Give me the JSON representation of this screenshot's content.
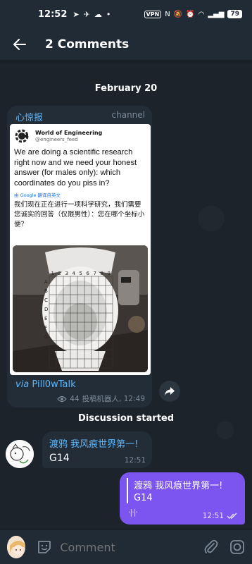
{
  "status_bar": {
    "time": "12:52",
    "vpn": "VPN",
    "battery": "79"
  },
  "header": {
    "title": "2 Comments"
  },
  "date_separator": "February 20",
  "channel_post": {
    "channel_name": "心惊报",
    "tag": "channel",
    "tweet": {
      "author": "World of Engineering",
      "handle": "@engineers_feed",
      "text": "We are doing a scientific research right now and we need your honest answer (for males only): which coordinates do you piss in?",
      "translate_label": "由 Google 翻译自英文",
      "translated_text": "我们现在正在进行一项科学研究，我们需要您诚实的回答（仅限男性）：您在哪个坐标小便？",
      "grid_columns": [
        "1",
        "2",
        "3",
        "4",
        "5",
        "6",
        "7",
        "8",
        "9"
      ],
      "grid_rows": [
        "A",
        "B",
        "C",
        "D",
        "E",
        "F",
        "G"
      ]
    },
    "via_prefix": "via",
    "via_name": "Pill0wTalk",
    "views": "44",
    "meta": "投稿机器人, 12:49"
  },
  "discussion_label": "Discussion started",
  "incoming_message": {
    "sender": "渡鸦 我风痕世界第一!",
    "text": "G14",
    "time": "12:51"
  },
  "outgoing_message": {
    "quote_name": "渡鸦 我风痕世界第一!",
    "quote_text": "G14",
    "time": "12:51"
  },
  "input_bar": {
    "placeholder": "Comment"
  },
  "colors": {
    "background": "#1c232b",
    "header": "#212b36",
    "bubble_in": "#232d38",
    "bubble_out": "#7c55f0",
    "link": "#5eb5f7",
    "muted": "#7d8b99"
  }
}
